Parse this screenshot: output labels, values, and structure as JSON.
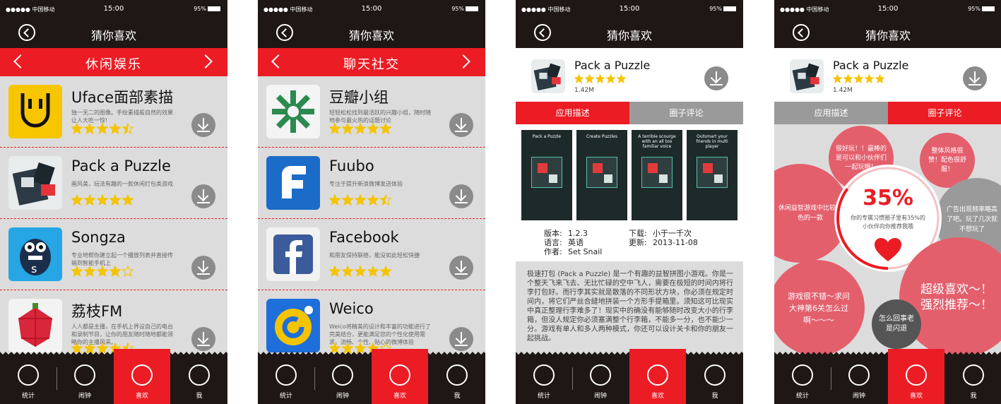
{
  "status": {
    "carrier": "●●●●● 中国移动",
    "time": "15:00",
    "battery": "95%"
  },
  "header": {
    "title": "猜你喜欢"
  },
  "screens": {
    "s1": {
      "category": "休闲娱乐",
      "apps": [
        {
          "name": "Uface面部素描",
          "desc": "独一无二的图像。手绘素描般自然的效果让人大吃一惊!",
          "rating": 4.5
        },
        {
          "name": "Pack a Puzzle",
          "desc": "画风美，玩法有趣的一款休闲打包类游戏",
          "rating": 5
        },
        {
          "name": "Songza",
          "desc": "专业地帮你建立起一个播放列表并直接传输到智能手机上",
          "rating": 4
        },
        {
          "name": "荔枝FM",
          "desc": "人人都是主播，在手机上界设自己的电台和录制节目，让你的朋友随时随地都能领略你的主播风采。",
          "rating": 4.5
        }
      ]
    },
    "s2": {
      "category": "聊天社交",
      "apps": [
        {
          "name": "豆瓣小组",
          "desc": "轻轻松松找到最活跃的兴趣小组，随时随地参与最火热的话题讨论",
          "rating": 5
        },
        {
          "name": "Fuubo",
          "desc": "专注于提升新浪微博发送体验",
          "rating": 4.5
        },
        {
          "name": "Facebook",
          "desc": "和朋友保持联络，能没如此轻松快捷",
          "rating": 5
        },
        {
          "name": "Weico",
          "desc": "Weico将精美的设计和丰富的功能进行了完美结合，更能满足您的个性化使用需求。流畅、个性、贴心的微博体验",
          "rating": 4
        }
      ]
    },
    "detail": {
      "name": "Pack a Puzzle",
      "rating": 5,
      "size": "1.42M",
      "tab_desc": "应用描述",
      "tab_reviews": "圈子评论",
      "shot_captions": [
        "Pack a Puzzle",
        "Create Puzzles",
        "A terrible scourge with an all too familiar voice",
        "Outsmart your friends in multi player"
      ],
      "info": {
        "version_label": "版本:",
        "version": "1.2.3",
        "lang_label": "语言:",
        "lang": "英语",
        "author_label": "作者:",
        "author": "Set Snail",
        "downloads_label": "下载:",
        "downloads": "小于一千次",
        "updated_label": "更新:",
        "updated": "2013-11-08"
      },
      "description": "极速打包 (Pack a Puzzle) 是一个有趣的益智拼图小游戏。你是一个整天飞来飞去、无比忙碌的空中飞人，需要在极短的时间内将行李打包好。而行李其实就是散落的不同形状方块，你必须在规定时间内，将它们严丝合缝地拼装一个方形手提箱里。须知这可比现实中真正整理行李难多了！现实中的确没有能够随时改变大小的行李箱，但没人规定你必须塞满整个行李箱，不能多一分，也不能少一分。游戏有单人和多人两种模式，你还可以设计关卡和你的朋友一起挑战。"
    },
    "reviews": {
      "percent": "35%",
      "percent_value": 35,
      "subtitle": "你的专属习惯圈子里有35%的小伙伴向你推荐我哦",
      "bubbles": [
        "很好玩！！最棒的是可以和小伙伴们一起玩哦！",
        "整体风格很赞！配色很舒服！",
        "休闲益智游戏中比较出色的一款",
        "广告出现频率略高了吧。玩了几次就不想玩了",
        "超级喜欢～！强烈推荐～！",
        "游戏很不错～求问大神第6关怎么过啊～～～",
        "怎么回事老是闪退"
      ]
    }
  },
  "nav": {
    "stats": "统计",
    "alarm": "闹钟",
    "like": "喜欢",
    "me": "我"
  },
  "colors": {
    "accent": "#ec1c24",
    "dark": "#1f1715",
    "star": "#f5c400",
    "bubble": "#e45f6c",
    "bubble_dark": "#555555"
  }
}
